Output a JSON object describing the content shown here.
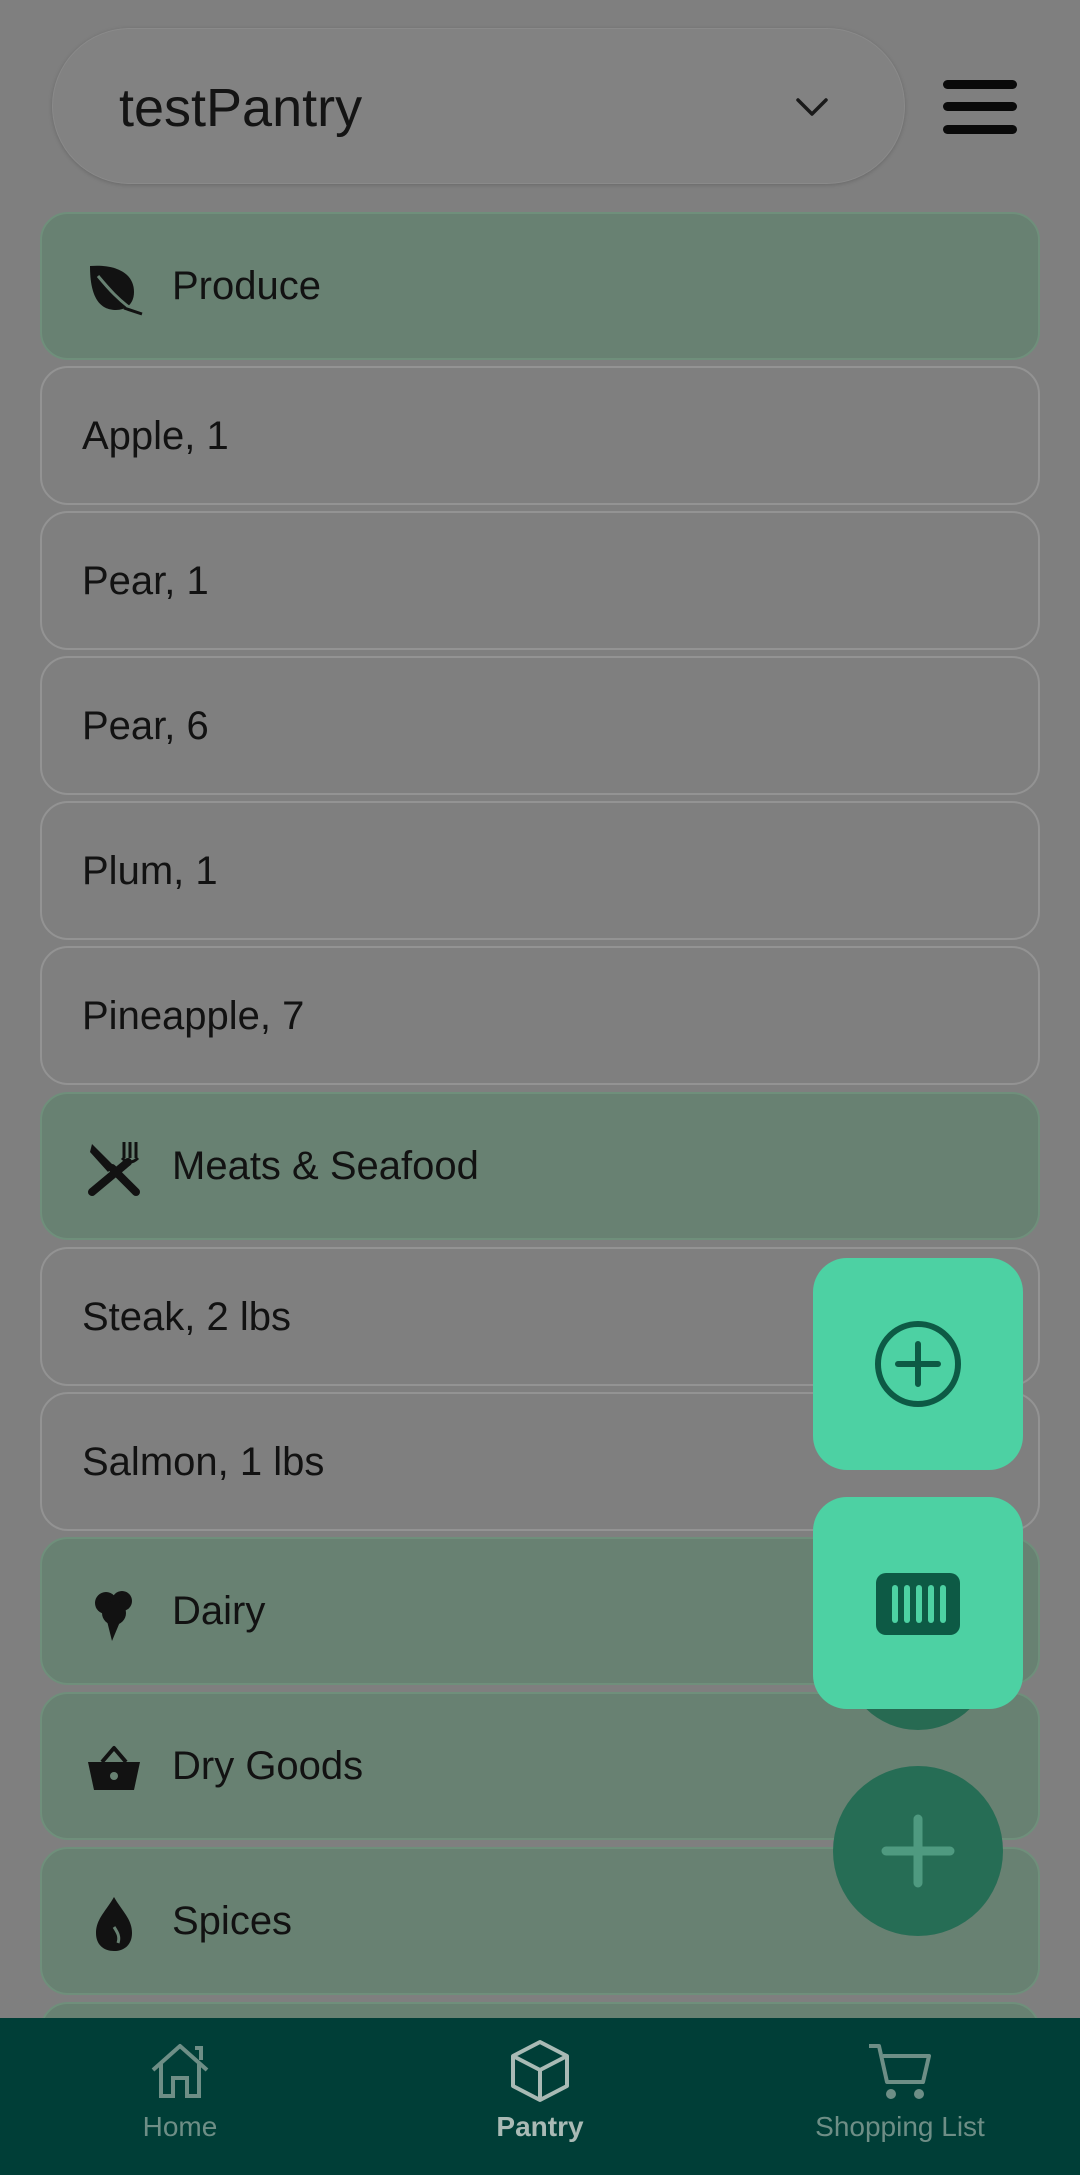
{
  "header": {
    "pantry_name": "testPantry",
    "menu_icon": "hamburger-menu-icon",
    "dropdown_icon": "chevron-down-icon"
  },
  "list": {
    "rows": [
      {
        "kind": "category",
        "label": "Produce",
        "icon": "leaf-icon"
      },
      {
        "kind": "item",
        "label": "Apple, 1"
      },
      {
        "kind": "item",
        "label": "Pear, 1"
      },
      {
        "kind": "item",
        "label": "Pear, 6"
      },
      {
        "kind": "item",
        "label": "Plum, 1"
      },
      {
        "kind": "item",
        "label": "Pineapple, 7"
      },
      {
        "kind": "category",
        "label": "Meats & Seafood",
        "icon": "utensils-icon"
      },
      {
        "kind": "item",
        "label": "Steak, 2 lbs"
      },
      {
        "kind": "item",
        "label": "Salmon, 1 lbs"
      },
      {
        "kind": "category",
        "label": "Dairy",
        "icon": "ice-cream-icon"
      },
      {
        "kind": "category",
        "label": "Dry Goods",
        "icon": "basket-icon"
      },
      {
        "kind": "category",
        "label": "Spices",
        "icon": "flame-icon"
      }
    ]
  },
  "fab": {
    "add_item_icon": "circle-plus-icon",
    "scan_barcode_icon": "barcode-icon",
    "main_icon": "plus-icon"
  },
  "bottom_nav": {
    "items": [
      {
        "label": "Home",
        "icon": "home-icon",
        "active": false
      },
      {
        "label": "Pantry",
        "icon": "box-icon",
        "active": true
      },
      {
        "label": "Shopping List",
        "icon": "cart-icon",
        "active": false
      }
    ]
  },
  "colors": {
    "overlay_gray": "#7f7f7f",
    "category_bg": "#688172",
    "fab_accent": "#4dd1a3",
    "fab_dark": "#266d55",
    "nav_bg": "#003e37"
  }
}
